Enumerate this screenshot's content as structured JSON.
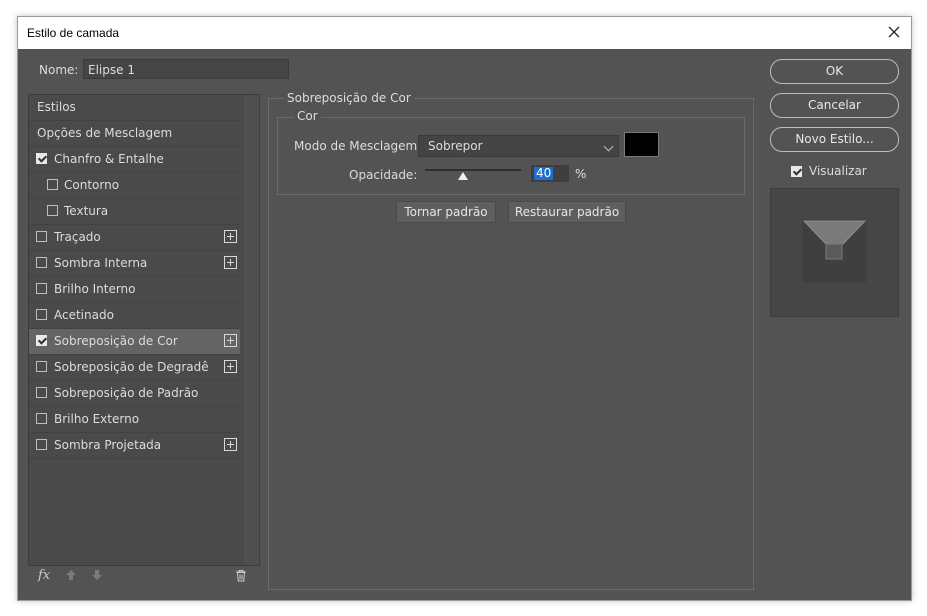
{
  "window": {
    "title": "Estilo de camada"
  },
  "name_field": {
    "label": "Nome:",
    "value": "Elipse 1"
  },
  "style_list": [
    {
      "label": "Estilos",
      "checkbox": false,
      "checked": false,
      "plus": false,
      "indent": false,
      "selected": false
    },
    {
      "label": "Opções de Mesclagem",
      "checkbox": false,
      "checked": false,
      "plus": false,
      "indent": false,
      "selected": false
    },
    {
      "label": "Chanfro & Entalhe",
      "checkbox": true,
      "checked": true,
      "plus": false,
      "indent": false,
      "selected": false
    },
    {
      "label": "Contorno",
      "checkbox": true,
      "checked": false,
      "plus": false,
      "indent": true,
      "selected": false
    },
    {
      "label": "Textura",
      "checkbox": true,
      "checked": false,
      "plus": false,
      "indent": true,
      "selected": false
    },
    {
      "label": "Traçado",
      "checkbox": true,
      "checked": false,
      "plus": true,
      "indent": false,
      "selected": false
    },
    {
      "label": "Sombra Interna",
      "checkbox": true,
      "checked": false,
      "plus": true,
      "indent": false,
      "selected": false
    },
    {
      "label": "Brilho Interno",
      "checkbox": true,
      "checked": false,
      "plus": false,
      "indent": false,
      "selected": false
    },
    {
      "label": "Acetinado",
      "checkbox": true,
      "checked": false,
      "plus": false,
      "indent": false,
      "selected": false
    },
    {
      "label": "Sobreposição de Cor",
      "checkbox": true,
      "checked": true,
      "plus": true,
      "indent": false,
      "selected": true
    },
    {
      "label": "Sobreposição de Degradê",
      "checkbox": true,
      "checked": false,
      "plus": true,
      "indent": false,
      "selected": false
    },
    {
      "label": "Sobreposição de Padrão",
      "checkbox": true,
      "checked": false,
      "plus": false,
      "indent": false,
      "selected": false
    },
    {
      "label": "Brilho Externo",
      "checkbox": true,
      "checked": false,
      "plus": false,
      "indent": false,
      "selected": false
    },
    {
      "label": "Sombra Projetada",
      "checkbox": true,
      "checked": false,
      "plus": true,
      "indent": false,
      "selected": false
    }
  ],
  "bottom_toolbar": {
    "fx_label": "fx"
  },
  "panel": {
    "title": "Sobreposição de Cor",
    "group_title": "Cor",
    "blend_mode_label": "Modo de Mesclagem:",
    "blend_mode_value": "Sobrepor",
    "overlay_color": "#000000",
    "opacity_label": "Opacidade:",
    "opacity_value": "40",
    "opacity_percent": 40,
    "percent_sign": "%",
    "make_default": "Tornar padrão",
    "reset_default": "Restaurar padrão"
  },
  "actions": {
    "ok": "OK",
    "cancel": "Cancelar",
    "new_style": "Novo Estilo...",
    "preview_label": "Visualizar",
    "preview_checked": true
  }
}
